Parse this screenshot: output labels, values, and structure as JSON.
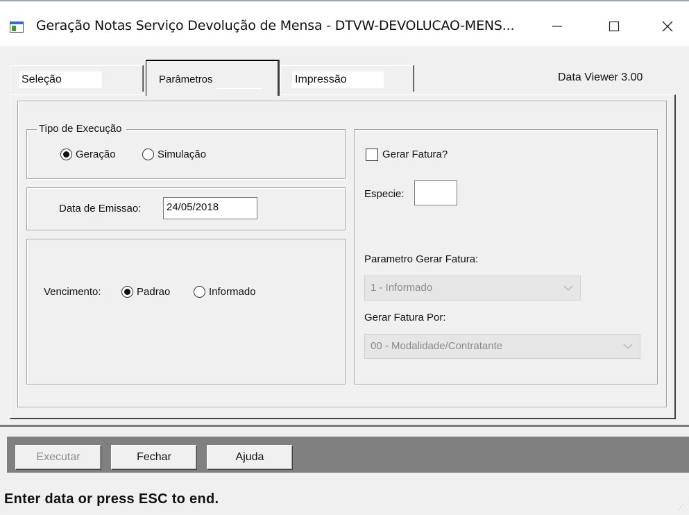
{
  "window": {
    "title": "Geração Notas Serviço Devolução de Mensa - DTVW-DEVOLUCAO-MENS...",
    "minimize_glyph": "—",
    "maximize_glyph": "☐",
    "close_glyph": "✕"
  },
  "tabs": [
    {
      "label": "Seleção",
      "selected": false
    },
    {
      "label": "Parâmetros",
      "selected": true
    },
    {
      "label": "Impressão",
      "selected": false
    }
  ],
  "version_label": "Data Viewer 3.00",
  "tipo_execucao": {
    "title": "Tipo de Execução",
    "options": [
      {
        "label": "Geração",
        "checked": true
      },
      {
        "label": "Simulação",
        "checked": false
      }
    ]
  },
  "data_emissao": {
    "label": "Data de Emissao:",
    "value": "24/05/2018"
  },
  "vencimento": {
    "label": "Vencimento:",
    "options": [
      {
        "label": "Padrao",
        "checked": true
      },
      {
        "label": "Informado",
        "checked": false
      }
    ]
  },
  "fatura": {
    "gerar_label": "Gerar Fatura?",
    "gerar_checked": false,
    "especie_label": "Especie:",
    "especie_value": "",
    "parametro_label": "Parametro Gerar Fatura:",
    "parametro_value": "1 - Informado",
    "por_label": "Gerar Fatura Por:",
    "por_value": "00 - Modalidade/Contratante"
  },
  "buttons": {
    "executar": "Executar",
    "fechar": "Fechar",
    "ajuda": "Ajuda"
  },
  "status_text": "Enter data or press ESC to end.",
  "icons": {
    "dropdown": "chevron-down-icon"
  }
}
